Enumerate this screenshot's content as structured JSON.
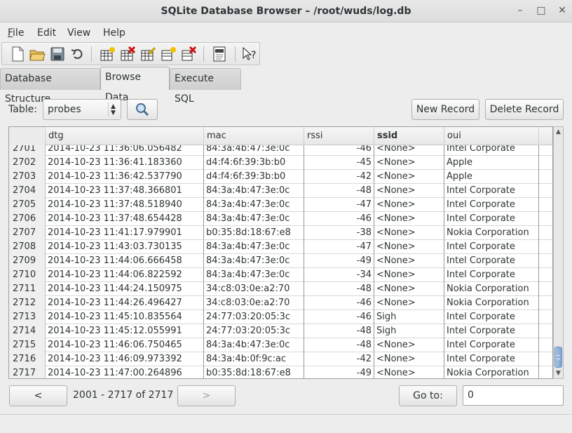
{
  "window": {
    "title": "SQLite Database Browser – /root/wuds/log.db",
    "minimize_glyph": "–",
    "maximize_glyph": "□",
    "close_glyph": "✕"
  },
  "menu": [
    "File",
    "Edit",
    "View",
    "Help"
  ],
  "toolbar": {
    "icons": [
      "new-database-icon",
      "open-database-icon",
      "save-icon",
      "undo-icon",
      "create-table-icon",
      "delete-table-icon",
      "modify-table-icon",
      "create-index-icon",
      "delete-index-icon",
      "sql-log-icon",
      "whats-this-icon"
    ]
  },
  "tabs": [
    "Database Structure",
    "Browse Data",
    "Execute SQL"
  ],
  "active_tab": "Browse Data",
  "filter": {
    "table_label": "Table:",
    "table_value": "probes",
    "search_icon": "magnifier-icon",
    "new_record_label": "New Record",
    "delete_record_label": "Delete Record"
  },
  "grid": {
    "columns": [
      "dtg",
      "mac",
      "rssi",
      "ssid",
      "oui"
    ],
    "sorted_column": "ssid",
    "rows": [
      [
        "2701",
        "2014-10-23 11:36:06.056482",
        "84:3a:4b:47:3e:0c",
        "-46",
        "<None>",
        "Intel Corporate"
      ],
      [
        "2702",
        "2014-10-23 11:36:41.183360",
        "d4:f4:6f:39:3b:b0",
        "-45",
        "<None>",
        "Apple"
      ],
      [
        "2703",
        "2014-10-23 11:36:42.537790",
        "d4:f4:6f:39:3b:b0",
        "-42",
        "<None>",
        "Apple"
      ],
      [
        "2704",
        "2014-10-23 11:37:48.366801",
        "84:3a:4b:47:3e:0c",
        "-48",
        "<None>",
        "Intel Corporate"
      ],
      [
        "2705",
        "2014-10-23 11:37:48.518940",
        "84:3a:4b:47:3e:0c",
        "-47",
        "<None>",
        "Intel Corporate"
      ],
      [
        "2706",
        "2014-10-23 11:37:48.654428",
        "84:3a:4b:47:3e:0c",
        "-46",
        "<None>",
        "Intel Corporate"
      ],
      [
        "2707",
        "2014-10-23 11:41:17.979901",
        "b0:35:8d:18:67:e8",
        "-38",
        "<None>",
        "Nokia Corporation"
      ],
      [
        "2708",
        "2014-10-23 11:43:03.730135",
        "84:3a:4b:47:3e:0c",
        "-47",
        "<None>",
        "Intel Corporate"
      ],
      [
        "2709",
        "2014-10-23 11:44:06.666458",
        "84:3a:4b:47:3e:0c",
        "-49",
        "<None>",
        "Intel Corporate"
      ],
      [
        "2710",
        "2014-10-23 11:44:06.822592",
        "84:3a:4b:47:3e:0c",
        "-34",
        "<None>",
        "Intel Corporate"
      ],
      [
        "2711",
        "2014-10-23 11:44:24.150975",
        "34:c8:03:0e:a2:70",
        "-48",
        "<None>",
        "Nokia Corporation"
      ],
      [
        "2712",
        "2014-10-23 11:44:26.496427",
        "34:c8:03:0e:a2:70",
        "-46",
        "<None>",
        "Nokia Corporation"
      ],
      [
        "2713",
        "2014-10-23 11:45:10.835564",
        "24:77:03:20:05:3c",
        "-46",
        "Sigh",
        "Intel Corporate"
      ],
      [
        "2714",
        "2014-10-23 11:45:12.055991",
        "24:77:03:20:05:3c",
        "-48",
        "Sigh",
        "Intel Corporate"
      ],
      [
        "2715",
        "2014-10-23 11:46:06.750465",
        "84:3a:4b:47:3e:0c",
        "-48",
        "<None>",
        "Intel Corporate"
      ],
      [
        "2716",
        "2014-10-23 11:46:09.973392",
        "84:3a:4b:0f:9c:ac",
        "-42",
        "<None>",
        "Intel Corporate"
      ],
      [
        "2717",
        "2014-10-23 11:47:00.264896",
        "b0:35:8d:18:67:e8",
        "-49",
        "<None>",
        "Nokia Corporation"
      ]
    ]
  },
  "scrollbar": {
    "up_glyph": "▲",
    "down_glyph": "▼",
    "position_fraction": 0.95
  },
  "footer": {
    "prev_label": "<",
    "range_text": "2001 - 2717 of 2717",
    "next_label": ">",
    "goto_label": "Go to:",
    "goto_value": "0"
  }
}
